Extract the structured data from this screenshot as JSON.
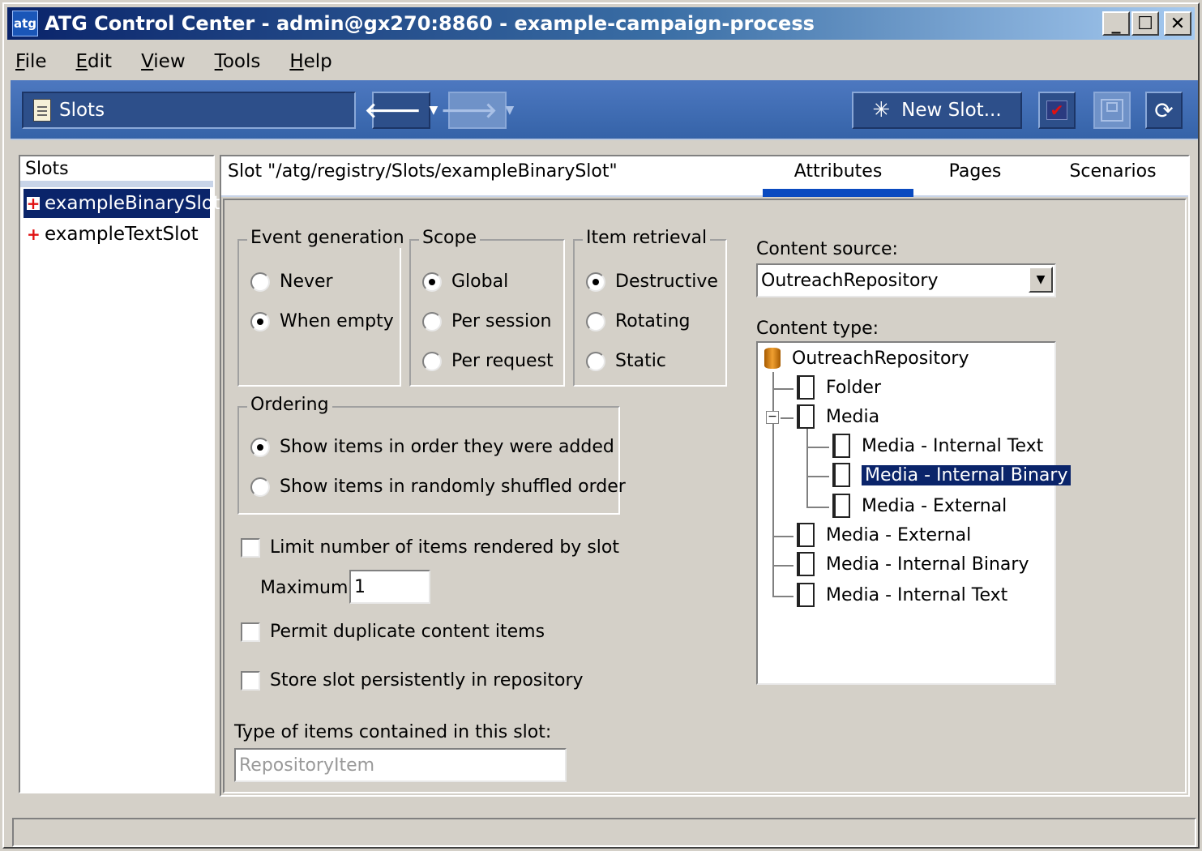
{
  "window": {
    "title": "ATG Control Center - admin@gx270:8860 - example-campaign-process",
    "app_icon": "atg",
    "controls": [
      "minimize-icon",
      "maximize-icon",
      "close-icon"
    ]
  },
  "menubar": {
    "items": [
      "File",
      "Edit",
      "View",
      "Tools",
      "Help"
    ]
  },
  "toolbar": {
    "nav_label": "Slots",
    "back_icon": "arrow-left-icon",
    "forward_icon": "arrow-right-icon",
    "new_slot_label": "New Slot...",
    "accent_color": "#3563a8"
  },
  "left_panel": {
    "header": "Slots",
    "items": [
      {
        "label": "exampleBinarySlot",
        "selected": true
      },
      {
        "label": "exampleTextSlot",
        "selected": false
      }
    ]
  },
  "main": {
    "slot_path": "Slot \"/atg/registry/Slots/exampleBinarySlot\"",
    "tabs": [
      {
        "label": "Attributes",
        "active": true
      },
      {
        "label": "Pages",
        "active": false
      },
      {
        "label": "Scenarios",
        "active": false
      }
    ],
    "event_generation": {
      "legend": "Event generation",
      "options": [
        {
          "label": "Never",
          "checked": false
        },
        {
          "label": "When empty",
          "checked": true
        }
      ]
    },
    "scope": {
      "legend": "Scope",
      "options": [
        {
          "label": "Global",
          "checked": true
        },
        {
          "label": "Per session",
          "checked": false
        },
        {
          "label": "Per request",
          "checked": false
        }
      ]
    },
    "item_retrieval": {
      "legend": "Item retrieval",
      "options": [
        {
          "label": "Destructive",
          "checked": true
        },
        {
          "label": "Rotating",
          "checked": false
        },
        {
          "label": "Static",
          "checked": false
        }
      ]
    },
    "ordering": {
      "legend": "Ordering",
      "options": [
        {
          "label": "Show items in order they were added",
          "checked": true
        },
        {
          "label": "Show items in randomly shuffled order",
          "checked": false
        }
      ]
    },
    "limit_checkbox": {
      "label": "Limit number of items rendered by slot",
      "checked": false
    },
    "maximum": {
      "label": "Maximum:",
      "value": "1"
    },
    "duplicate_checkbox": {
      "label": "Permit duplicate content items",
      "checked": false
    },
    "persist_checkbox": {
      "label": "Store slot persistently in repository",
      "checked": false
    },
    "item_type": {
      "label": "Type of items contained in this slot:",
      "value": "RepositoryItem"
    },
    "content_source": {
      "label": "Content source:",
      "value": "OutreachRepository"
    },
    "content_type": {
      "label": "Content type:",
      "root": "OutreachRepository",
      "nodes": [
        {
          "label": "Folder"
        },
        {
          "label": "Media",
          "children": [
            "Media - Internal Text",
            "Media - Internal Binary",
            "Media - External"
          ]
        },
        {
          "label": "Media - External"
        },
        {
          "label": "Media - Internal Binary"
        },
        {
          "label": "Media - Internal Text"
        }
      ],
      "selected": "Media - Internal Binary"
    }
  }
}
